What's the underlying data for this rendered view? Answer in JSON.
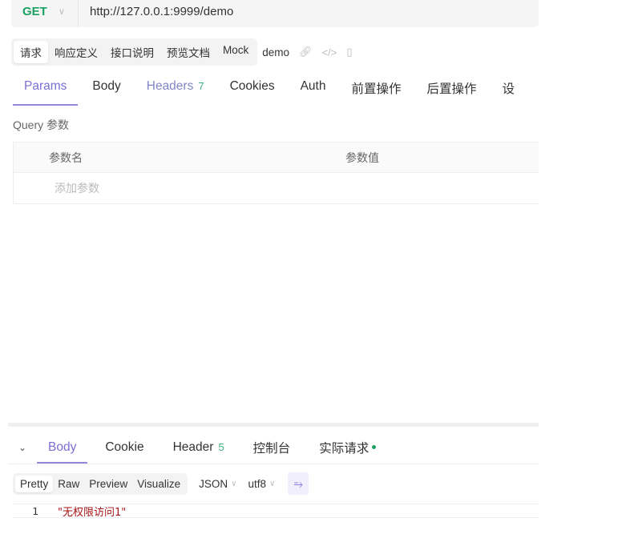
{
  "request": {
    "method": "GET",
    "url": "http://127.0.0.1:9999/demo"
  },
  "modes": [
    "请求",
    "响应定义",
    "接口说明",
    "预览文档",
    "Mock"
  ],
  "api_name": "demo",
  "tabs": {
    "params": "Params",
    "body": "Body",
    "headers": "Headers",
    "headers_count": "7",
    "cookies": "Cookies",
    "auth": "Auth",
    "pre": "前置操作",
    "post": "后置操作",
    "settings": "设"
  },
  "query": {
    "title": "Query 参数",
    "col_name": "参数名",
    "col_value": "参数值",
    "add_placeholder": "添加参数"
  },
  "response": {
    "tabs": {
      "body": "Body",
      "cookie": "Cookie",
      "header": "Header",
      "header_count": "5",
      "console": "控制台",
      "actual": "实际请求"
    },
    "formats": [
      "Pretty",
      "Raw",
      "Preview",
      "Visualize"
    ],
    "type": "JSON",
    "encoding": "utf8",
    "lines": [
      {
        "no": "1",
        "text": "\"无权限访问1\""
      }
    ]
  }
}
